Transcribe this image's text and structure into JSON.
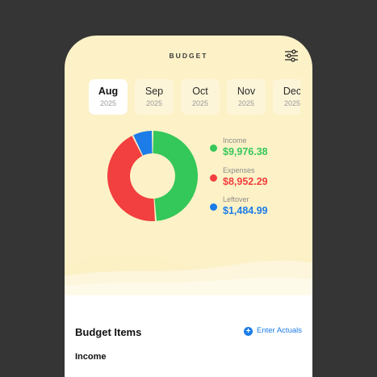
{
  "header": {
    "title": "BUDGET",
    "filter_icon": "sliders-icon"
  },
  "months": [
    {
      "name": "Aug",
      "year": "2025",
      "selected": true
    },
    {
      "name": "Sep",
      "year": "2025",
      "selected": false
    },
    {
      "name": "Oct",
      "year": "2025",
      "selected": false
    },
    {
      "name": "Nov",
      "year": "2025",
      "selected": false
    },
    {
      "name": "Dec",
      "year": "2025",
      "selected": false
    }
  ],
  "summary": {
    "items": [
      {
        "label": "Income",
        "value": "$9,976.38",
        "color": "#34c759"
      },
      {
        "label": "Expenses",
        "value": "$8,952.29",
        "color": "#f23f3f"
      },
      {
        "label": "Leftover",
        "value": "$1,484.99",
        "color": "#1c7ce8"
      }
    ]
  },
  "donut": {
    "segments": [
      {
        "name": "Income",
        "value": 9976.38,
        "color": "#34c759"
      },
      {
        "name": "Expenses",
        "value": 8952.29,
        "color": "#f23f3f"
      },
      {
        "name": "Leftover",
        "value": 1484.99,
        "color": "#1c7ce8"
      }
    ]
  },
  "budget_items": {
    "title": "Budget Items",
    "enter_actuals_label": "Enter Actuals",
    "enter_actuals_icon": "plus-circle-icon",
    "first_section": "Income"
  }
}
